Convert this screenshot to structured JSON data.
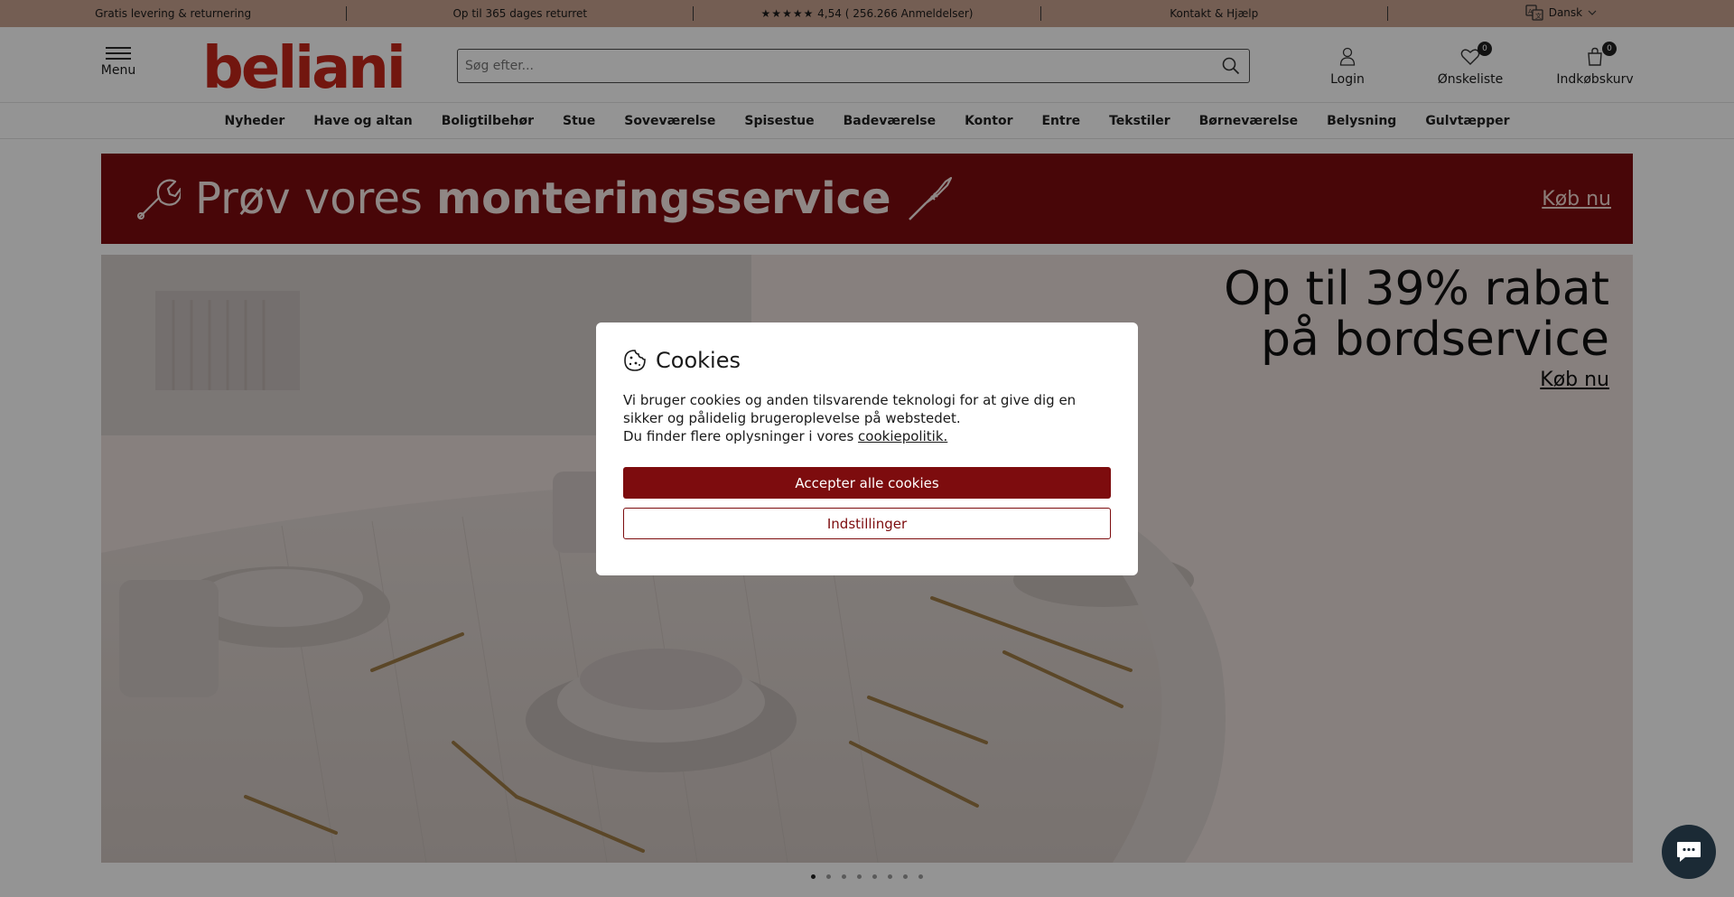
{
  "topbar": {
    "free_shipping": "Gratis levering & returnering",
    "returns": "Op til 365 dages returret",
    "stars": "★★★★★",
    "rating": "4,54 ( 256.266 Anmeldelser)",
    "contact": "Kontakt & Hjælp",
    "language": "Dansk"
  },
  "header": {
    "menu_label": "Menu",
    "logo_text": "beliani",
    "search_placeholder": "Søg efter...",
    "login_label": "Login",
    "wishlist_label": "Ønskeliste",
    "wishlist_count": "0",
    "cart_label": "Indkøbskurv",
    "cart_count": "0"
  },
  "nav": {
    "items": [
      "Nyheder",
      "Have og altan",
      "Boligtilbehør",
      "Stue",
      "Soveværelse",
      "Spisestue",
      "Badeværelse",
      "Kontor",
      "Entre",
      "Tekstiler",
      "Børneværelse",
      "Belysning",
      "Gulvtæpper"
    ]
  },
  "promo": {
    "text_light": "Prøv vores ",
    "text_bold": "monteringsservice",
    "cta": "Køb nu"
  },
  "hero": {
    "title_line1": "Op til 39% rabat",
    "title_line2": "på bordservice",
    "cta": "Køb nu"
  },
  "carousel": {
    "slide_count": 8,
    "active_index": 0
  },
  "cookie_modal": {
    "title": "Cookies",
    "text_line1": "Vi bruger cookies og anden tilsvarende teknologi for at give dig en sikker og pålidelig brugeroplevelse på webstedet.",
    "text_line2_prefix": "Du finder flere oplysninger i vores ",
    "policy_link": "cookiepolitik.",
    "accept_label": "Accepter alle cookies",
    "settings_label": "Indstillinger"
  },
  "colors": {
    "topbar_bg": "#c9a38f",
    "brand_red": "#c4271b",
    "accent_dark_red": "#7d0c0e"
  },
  "icons": [
    "language-icon",
    "menu-icon",
    "search-icon",
    "user-icon",
    "heart-icon",
    "cart-icon",
    "wrench-icon",
    "screwdriver-icon",
    "cookie-icon",
    "chat-icon"
  ]
}
